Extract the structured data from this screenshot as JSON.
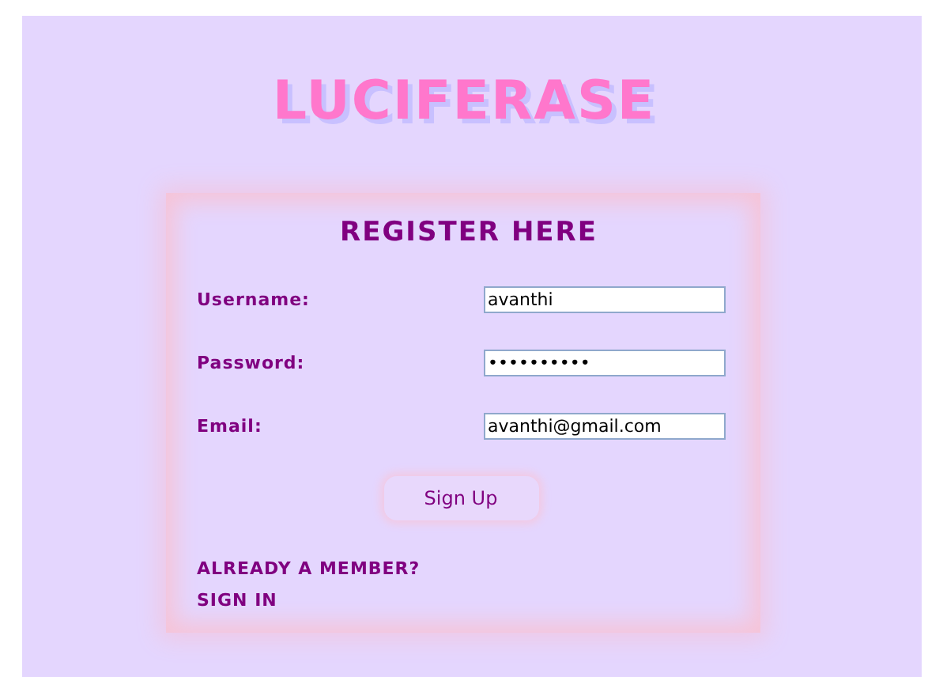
{
  "title": "LUCIFERASE",
  "form": {
    "heading": "REGISTER HERE",
    "fields": [
      {
        "label": "Username:",
        "value": "avanthi"
      },
      {
        "label": "Password:",
        "value": "••••••••••"
      },
      {
        "label": "Email:",
        "value": "avanthi@gmail.com"
      }
    ],
    "submit": "Sign Up",
    "member_prompt": "ALREADY A MEMBER?",
    "sign_in_link": "SIGN IN"
  }
}
